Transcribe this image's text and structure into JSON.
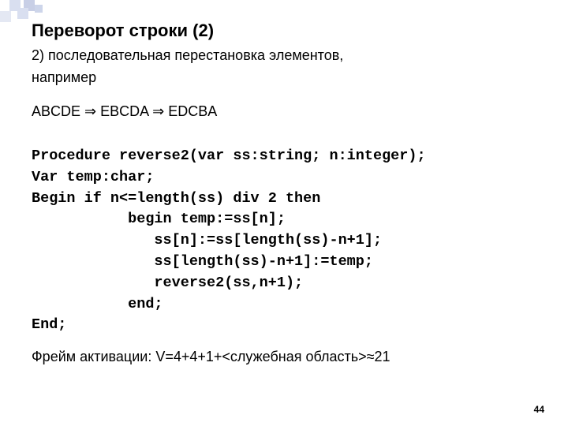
{
  "title": "Переворот строки (2)",
  "intro_line1": "2) последовательная перестановка элементов,",
  "intro_line2": "например",
  "example": "ABCDE  ⇒ EBCDA ⇒ EDCBA",
  "code": "Procedure reverse2(var ss:string; n:integer);\nVar temp:char;\nBegin if n<=length(ss) div 2 then\n           begin temp:=ss[n];\n              ss[n]:=ss[length(ss)-n+1];\n              ss[length(ss)-n+1]:=temp;\n              reverse2(ss,n+1);\n           end;\nEnd;",
  "frame_line": "Фрейм активации: V=4+4+1+<служебная область>≈21",
  "page_number": "44"
}
